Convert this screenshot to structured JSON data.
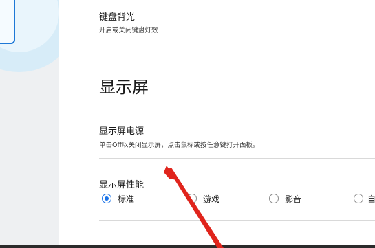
{
  "keyboard_backlight": {
    "title": "键盘背光",
    "description": "开启或关闭键盘灯效"
  },
  "display_section": {
    "heading": "显示屏"
  },
  "display_power": {
    "title": "显示屏电源",
    "description": "单击Off以关闭显示屏，点击鼠标或按任意键打开面板。"
  },
  "display_performance": {
    "title": "显示屏性能",
    "options": [
      {
        "label": "标准",
        "checked": true
      },
      {
        "label": "游戏",
        "checked": false
      },
      {
        "label": "影音",
        "checked": false
      },
      {
        "label": "自",
        "checked": false
      }
    ]
  },
  "colors": {
    "accent": "#1a73e8",
    "annotation_arrow": "#e0241c"
  }
}
